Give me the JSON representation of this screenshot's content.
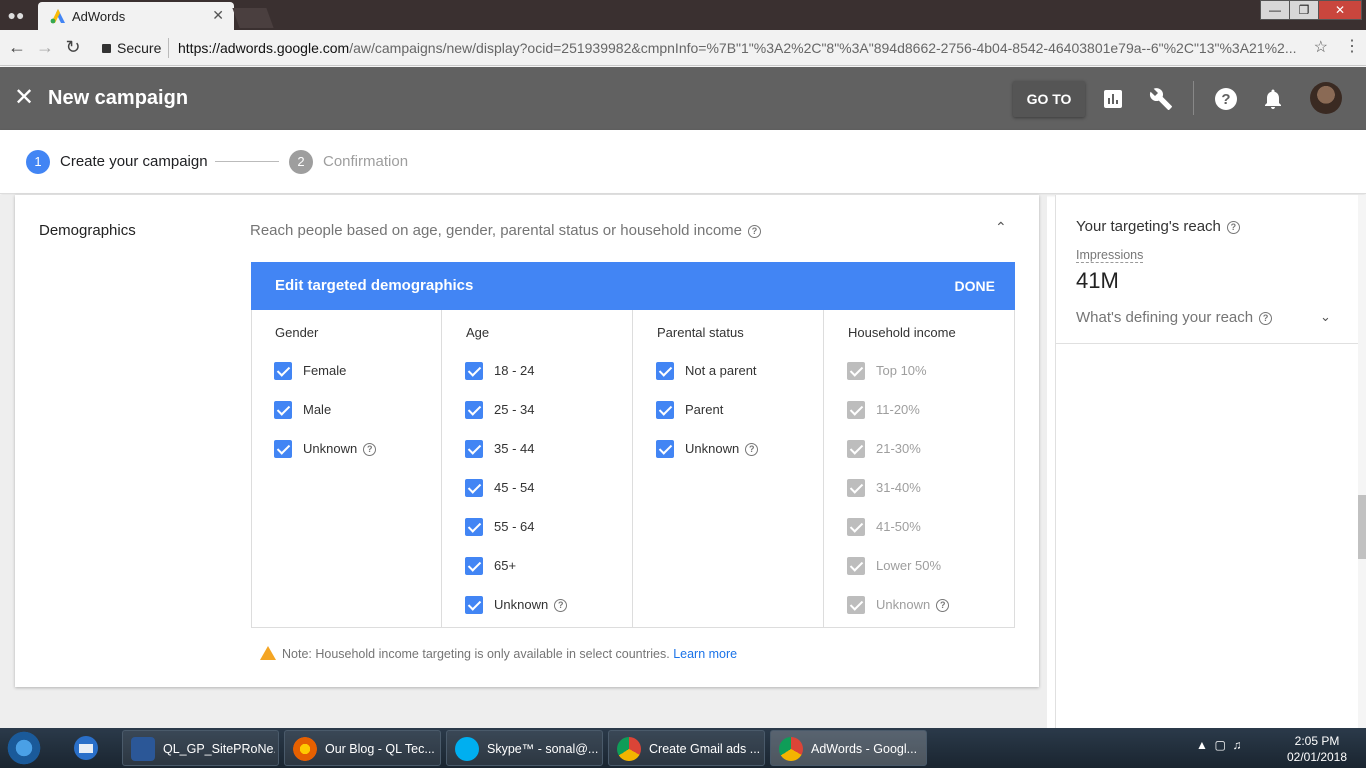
{
  "browser": {
    "tab_title": "AdWords",
    "secure_label": "Secure",
    "url_host": "https://adwords.google.com",
    "url_path": "/aw/campaigns/new/display?ocid=251939982&cmpnInfo=%7B\"1\"%3A2%2C\"8\"%3A\"894d8662-2756-4b04-8542-46403801e79a--6\"%2C\"13\"%3A21%2..."
  },
  "header": {
    "title": "New campaign",
    "goto_label": "GO TO"
  },
  "stepper": {
    "step1_num": "1",
    "step1_label": "Create your campaign",
    "step2_num": "2",
    "step2_label": "Confirmation"
  },
  "demographics": {
    "section_title": "Demographics",
    "description": "Reach people based on age, gender, parental status or household income",
    "panel_title": "Edit targeted demographics",
    "done_label": "DONE",
    "columns": [
      {
        "heading": "Gender",
        "options": [
          {
            "label": "Female",
            "checked": true,
            "disabled": false,
            "help": false
          },
          {
            "label": "Male",
            "checked": true,
            "disabled": false,
            "help": false
          },
          {
            "label": "Unknown",
            "checked": true,
            "disabled": false,
            "help": true
          }
        ]
      },
      {
        "heading": "Age",
        "options": [
          {
            "label": "18 - 24",
            "checked": true,
            "disabled": false,
            "help": false
          },
          {
            "label": "25 - 34",
            "checked": true,
            "disabled": false,
            "help": false
          },
          {
            "label": "35 - 44",
            "checked": true,
            "disabled": false,
            "help": false
          },
          {
            "label": "45 - 54",
            "checked": true,
            "disabled": false,
            "help": false
          },
          {
            "label": "55 - 64",
            "checked": true,
            "disabled": false,
            "help": false
          },
          {
            "label": "65+",
            "checked": true,
            "disabled": false,
            "help": false
          },
          {
            "label": "Unknown",
            "checked": true,
            "disabled": false,
            "help": true
          }
        ]
      },
      {
        "heading": "Parental status",
        "options": [
          {
            "label": "Not a parent",
            "checked": true,
            "disabled": false,
            "help": false
          },
          {
            "label": "Parent",
            "checked": true,
            "disabled": false,
            "help": false
          },
          {
            "label": "Unknown",
            "checked": true,
            "disabled": false,
            "help": true
          }
        ]
      },
      {
        "heading": "Household income",
        "options": [
          {
            "label": "Top 10%",
            "checked": true,
            "disabled": true,
            "help": false
          },
          {
            "label": "11-20%",
            "checked": true,
            "disabled": true,
            "help": false
          },
          {
            "label": "21-30%",
            "checked": true,
            "disabled": true,
            "help": false
          },
          {
            "label": "31-40%",
            "checked": true,
            "disabled": true,
            "help": false
          },
          {
            "label": "41-50%",
            "checked": true,
            "disabled": true,
            "help": false
          },
          {
            "label": "Lower 50%",
            "checked": true,
            "disabled": true,
            "help": false
          },
          {
            "label": "Unknown",
            "checked": true,
            "disabled": true,
            "help": true
          }
        ]
      }
    ],
    "note_text": "Note: Household income targeting is only available in select countries.",
    "learn_more": "Learn more"
  },
  "reach": {
    "title": "Your targeting's reach",
    "impressions_label": "Impressions",
    "impressions_value": "41M",
    "defining_label": "What's defining your reach"
  },
  "taskbar": {
    "items": [
      "QL_GP_SitePRoNe...",
      "Our Blog - QL Tec...",
      "Skype™ - sonal@...",
      "Create Gmail ads ...",
      "AdWords - Googl..."
    ],
    "time": "2:05 PM",
    "date": "02/01/2018"
  },
  "colors": {
    "accent_blue": "#4285f4",
    "header_gray": "#616161",
    "warning_orange": "#f4a524",
    "link_blue": "#1a73e8"
  }
}
